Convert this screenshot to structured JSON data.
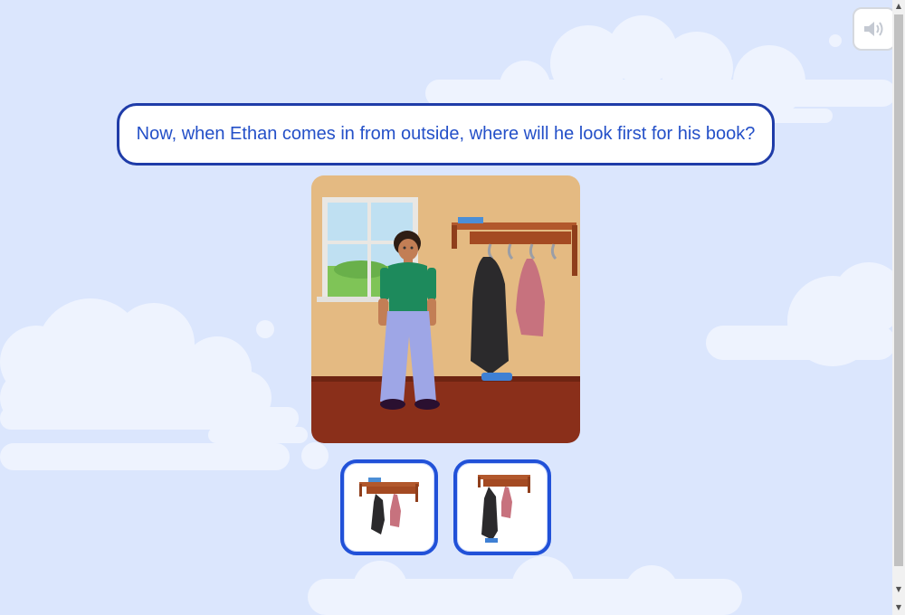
{
  "prompt": {
    "text": "Now, when Ethan comes in from outside, where will he look first for his book?"
  },
  "sound_button": {
    "icon": "speaker-icon"
  },
  "scene": {
    "icon": "room-scene-illustration"
  },
  "choices": [
    {
      "icon": "shelf-with-book-on-top-icon"
    },
    {
      "icon": "shelf-with-book-on-floor-icon"
    }
  ],
  "scrollbar": {
    "up_arrow": "▲",
    "down_arrow": "▼"
  },
  "colors": {
    "background": "#dbe6fd",
    "accent": "#1f3ca8",
    "prompt_text": "#2450c8",
    "choice_border": "#2151d8"
  }
}
